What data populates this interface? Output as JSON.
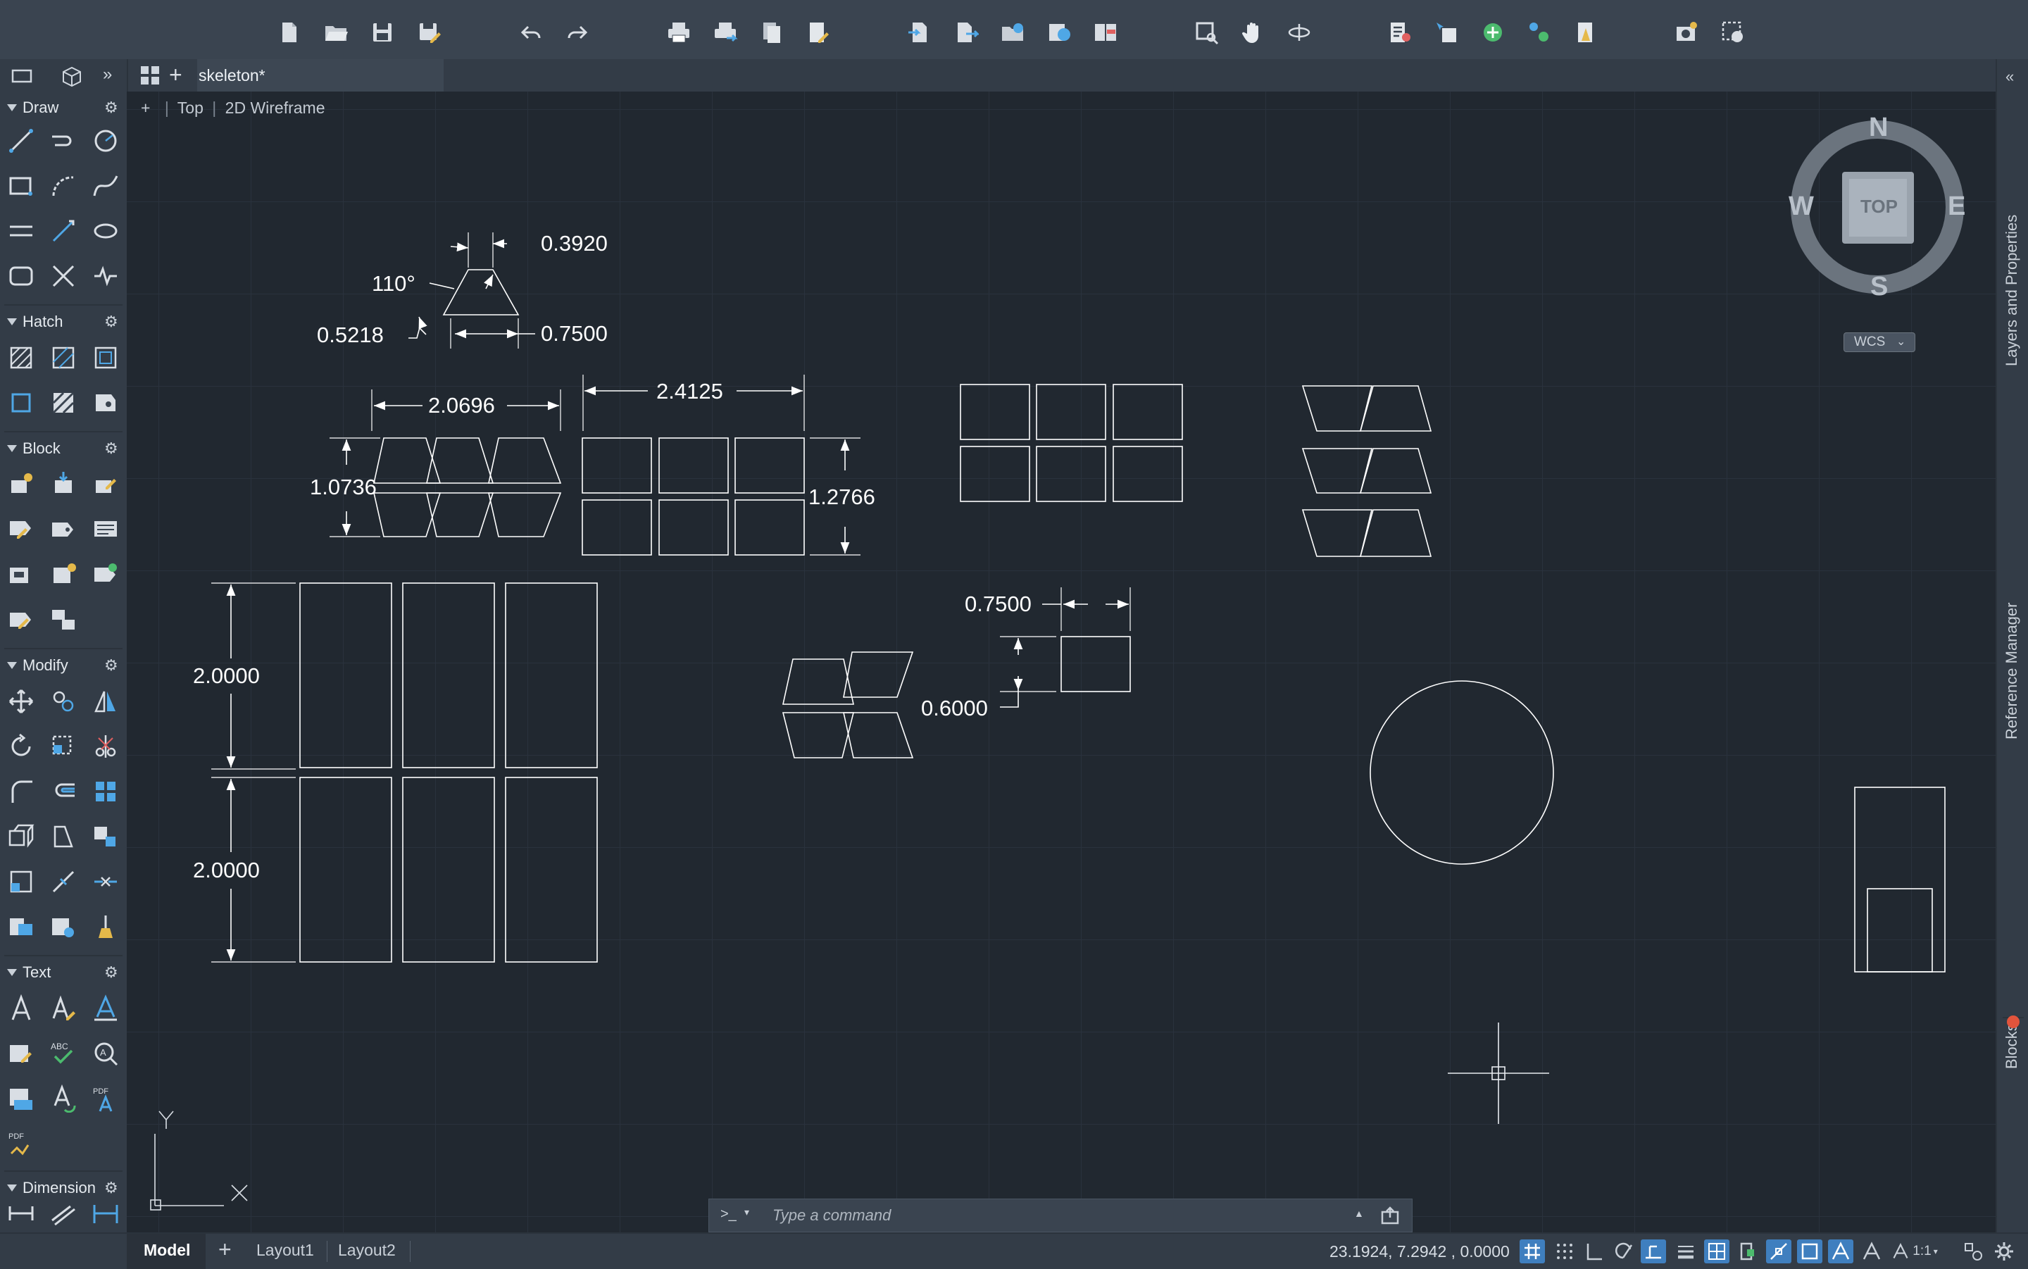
{
  "document": {
    "tab_title": "skeleton*"
  },
  "viewport": {
    "view_controls": {
      "plus": "+",
      "view": "Top",
      "style": "2D Wireframe"
    },
    "viewcube": {
      "north": "N",
      "south": "S",
      "east": "E",
      "west": "W",
      "face": "TOP",
      "ucs": "WCS"
    },
    "ucs_icon": {
      "x": "X",
      "y": "Y"
    },
    "dimensions": {
      "d1": "0.3920",
      "d2": "110°",
      "d3": "0.5218",
      "d4": "0.7500",
      "d5": "2.0696",
      "d6": "2.4125",
      "d7": "1.0736",
      "d8": "1.2766",
      "d9": "2.0000",
      "d10": "2.0000",
      "d11": "0.7500",
      "d12": "0.6000"
    }
  },
  "sidebar": {
    "panels": [
      {
        "title": "Draw"
      },
      {
        "title": "Hatch"
      },
      {
        "title": "Block"
      },
      {
        "title": "Modify"
      },
      {
        "title": "Text"
      },
      {
        "title": "Dimension"
      }
    ]
  },
  "right_palettes": {
    "layers": "Layers and Properties",
    "refs": "Reference Manager",
    "blocks": "Blocks"
  },
  "command_line": {
    "prompt": ">_",
    "placeholder": "Type a command"
  },
  "layout_tabs": {
    "model": "Model",
    "layout1": "Layout1",
    "layout2": "Layout2"
  },
  "status_bar": {
    "coordinates": "23.1924, 7.2942 , 0.0000",
    "scale": "1:1"
  }
}
